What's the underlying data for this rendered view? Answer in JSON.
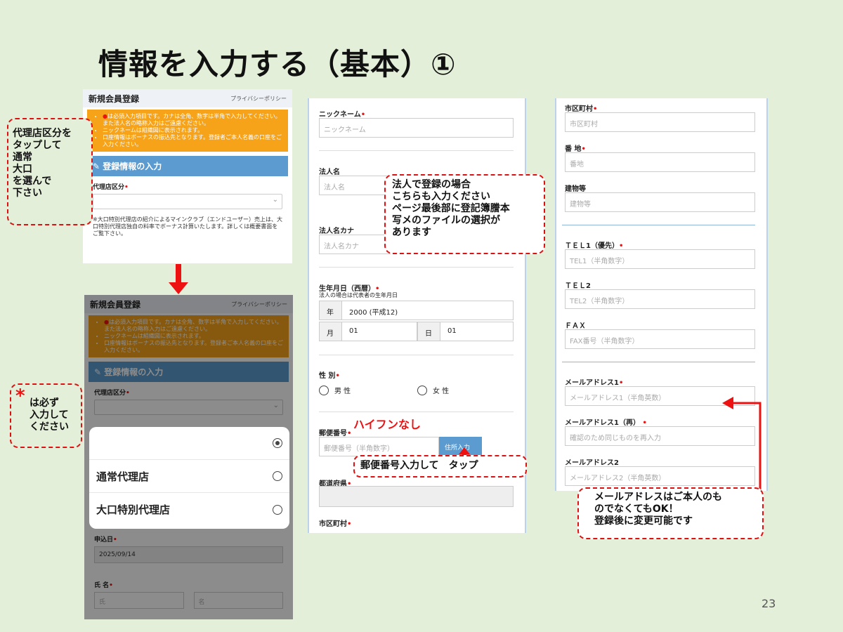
{
  "slide": {
    "title": "情報を入力する（基本）①",
    "page_number": "23"
  },
  "form": {
    "header_title": "新規会員登録",
    "privacy_link": "プライバシーポリシー",
    "notices": [
      "は必須入力項目です。カナは全角、数字は半角で入力してください。また法人名の略称入力はご遠慮ください。",
      "ニックネームは組織図に表示されます。",
      "口座情報はボーナスの振込先となります。登録者ご本人名義の口座をご入力ください。"
    ],
    "notice_star": "●",
    "section_title": "登録情報の入力",
    "agency_label": "代理店区分",
    "agency_note": "※大口特別代理店の紹介によるマインクラブ（エンドユーザー）売上は、大口特別代理店独自の料率でボーナス計算いたします。詳しくは概要書面をご覧下さい。",
    "apply_date_label": "申込日",
    "apply_date_value": "2025/09/14",
    "name_label": "氏 名",
    "last_name_placeholder": "氏",
    "first_name_placeholder": "名"
  },
  "popup": {
    "options": [
      "",
      "通常代理店",
      "大口特別代理店"
    ],
    "selected_index": 0
  },
  "middle": {
    "nickname_label": "ニックネーム",
    "nickname_placeholder": "ニックネーム",
    "corp_label": "法人名",
    "corp_placeholder": "法人名",
    "corp_kana_label": "法人名カナ",
    "corp_kana_placeholder": "法人名カナ",
    "birth_label": "生年月日（西暦）",
    "birth_note": "法人の場合は代表者の生年月日",
    "year_label": "年",
    "year_value": "2000 (平成12)",
    "month_label": "月",
    "month_value": "01",
    "day_label": "日",
    "day_value": "01",
    "gender_label": "性 別",
    "male": "男 性",
    "female": "女 性",
    "zip_label": "郵便番号",
    "zip_placeholder": "郵便番号（半角数字）",
    "zip_button": "住所入力",
    "pref_label": "都道府県",
    "city_label": "市区町村"
  },
  "right": {
    "city_label": "市区町村",
    "city_placeholder": "市区町村",
    "addr_label": "番 地",
    "addr_placeholder": "番地",
    "bldg_label": "建物等",
    "bldg_placeholder": "建物等",
    "tel1_label": "ＴＥＬ1（優先）",
    "tel1_placeholder": "TEL1（半角数字）",
    "tel2_label": "ＴＥＬ2",
    "tel2_placeholder": "TEL2（半角数字）",
    "fax_label": "ＦＡＸ",
    "fax_placeholder": "FAX番号（半角数字）",
    "mail1_label": "メールアドレス1",
    "mail1_placeholder": "メールアドレス1（半角英数）",
    "mail1r_label": "メールアドレス1（再）",
    "mail1r_placeholder": "確認のため同じものを再入力",
    "mail2_label": "メールアドレス2",
    "mail2_placeholder": "メールアドレス2（半角英数）"
  },
  "callouts": {
    "agency": "代理店区分を\nタップして\n通常\n大口\nを選んで\n下さい",
    "required_star": "*",
    "required": "は必ず\n入力して\nください",
    "corp": "法人で登録の場合\nこちらも入力ください\nページ最後部に登記簿謄本\n写メのファイルの選択が\nあります",
    "no_hyphen": "ハイフンなし",
    "zip_tap": "郵便番号入力して　タップ",
    "mail": "メールアドレスはご本人のも\nのでなくてもOK！\n登録後に変更可能です"
  },
  "colors": {
    "background": "#e4efd9",
    "accent_red": "#e11111",
    "notice_orange": "#f6a31a",
    "section_blue": "#5b9bcf"
  }
}
